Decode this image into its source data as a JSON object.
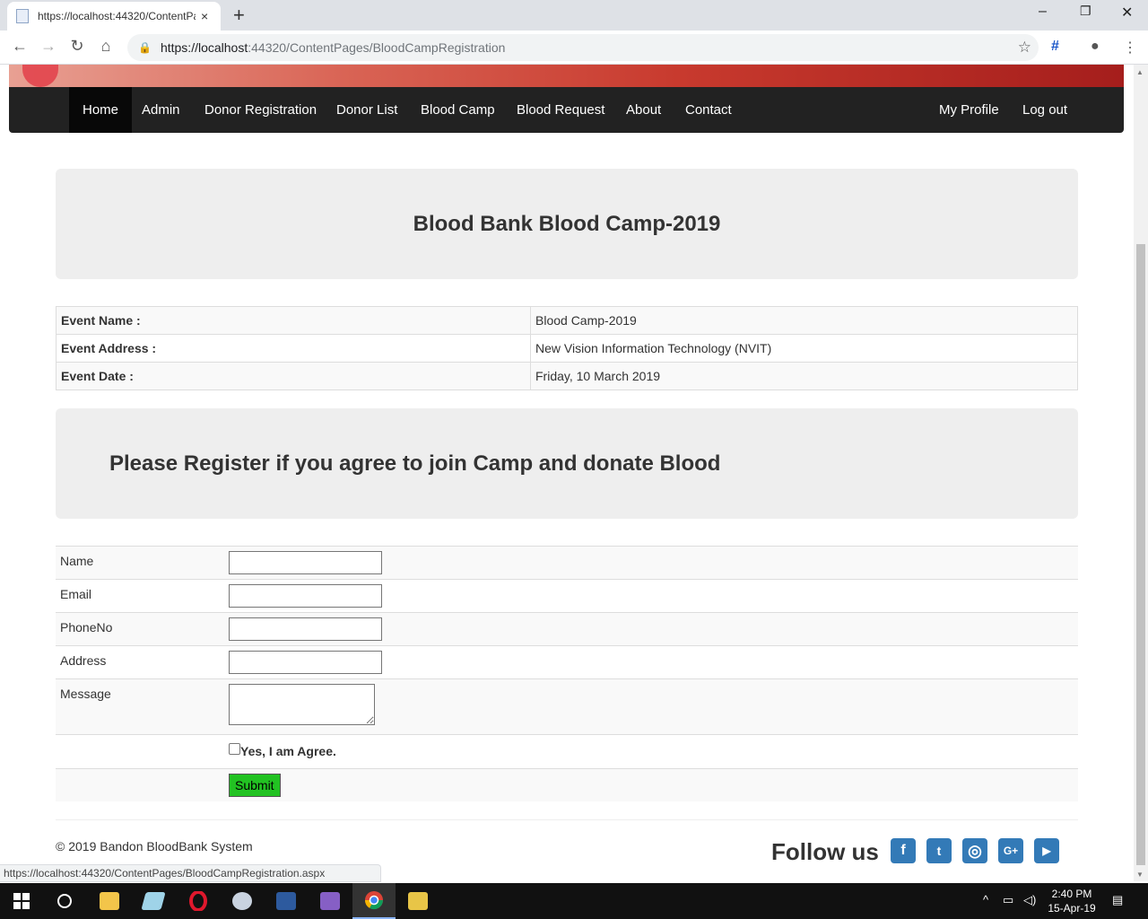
{
  "browser": {
    "tab_title": "https://localhost:44320/ContentPages/BloodCampRegistration",
    "new_tab": "+",
    "close_tab": "×",
    "url_host": "https://localhost",
    "url_rest": ":44320/ContentPages/BloodCampRegistration",
    "status_url": "https://localhost:44320/ContentPages/BloodCampRegistration.aspx"
  },
  "nav": {
    "left": [
      "Home",
      "Admin",
      "Donor Registration",
      "Donor List",
      "Blood Camp",
      "Blood Request",
      "About",
      "Contact"
    ],
    "right": [
      "My Profile",
      "Log out"
    ]
  },
  "header": {
    "title": "Blood Bank Blood Camp-2019"
  },
  "event": {
    "rows": [
      {
        "label": "Event Name :",
        "value": "Blood Camp-2019"
      },
      {
        "label": "Event Address :",
        "value": "New Vision Information Technology (NVIT)"
      },
      {
        "label": "Event Date :",
        "value": "Friday, 10 March 2019"
      }
    ]
  },
  "register": {
    "heading": "Please Register if you agree to join Camp and donate Blood"
  },
  "form": {
    "name_label": "Name",
    "email_label": "Email",
    "phone_label": "PhoneNo",
    "address_label": "Address",
    "message_label": "Message",
    "agree_label": "Yes, I am Agree.",
    "submit_label": "Submit",
    "name_value": "",
    "email_value": "",
    "phone_value": "",
    "address_value": ""
  },
  "footer": {
    "copyright": "© 2019 Bandon BloodBank System",
    "follow": "Follow us",
    "social_icons": [
      "facebook-icon",
      "twitter-icon",
      "instagram-icon",
      "google-plus-icon",
      "youtube-icon"
    ]
  },
  "taskbar": {
    "time": "2:40 PM",
    "date": "15-Apr-19"
  },
  "colors": {
    "navbar": "#222222",
    "submit": "#22c222",
    "social": "#337ab7"
  }
}
